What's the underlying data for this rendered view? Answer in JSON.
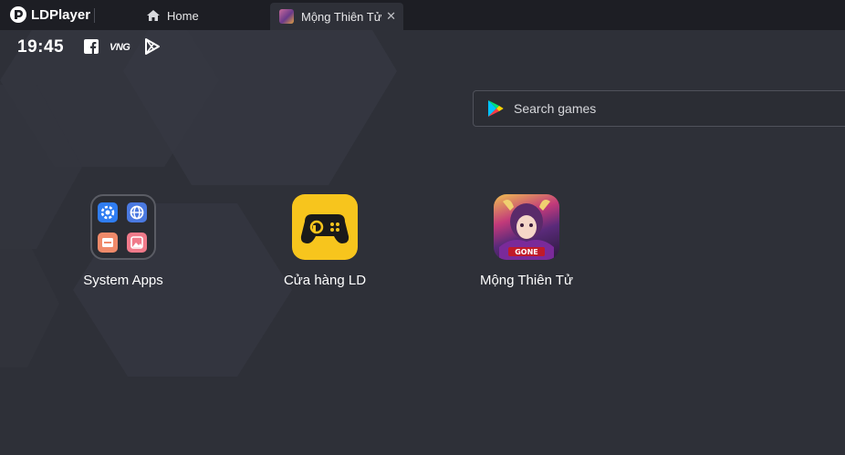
{
  "titlebar": {
    "logo_text": "LDPlayer",
    "tabs": [
      {
        "label": "Home",
        "icon": "home-icon"
      },
      {
        "label": "Mộng Thiên Tử",
        "icon": "game-tab-icon",
        "close_glyph": "✕"
      }
    ]
  },
  "status_bar": {
    "time": "19:45",
    "icons": [
      "facebook-icon",
      "vng-icon",
      "play-outline-icon"
    ],
    "vng_text": "VNG"
  },
  "search": {
    "placeholder": "Search games"
  },
  "apps": [
    {
      "label": "System Apps",
      "icon": "system-apps-folder-icon"
    },
    {
      "label": "Cửa hàng LD",
      "icon": "ld-store-icon"
    },
    {
      "label": "Mộng Thiên Tử",
      "icon": "mong-thien-tu-icon"
    }
  ],
  "colors": {
    "background": "#2e3038",
    "titlebar": "#1d1e24",
    "ld_store_yellow": "#f7c51d"
  }
}
